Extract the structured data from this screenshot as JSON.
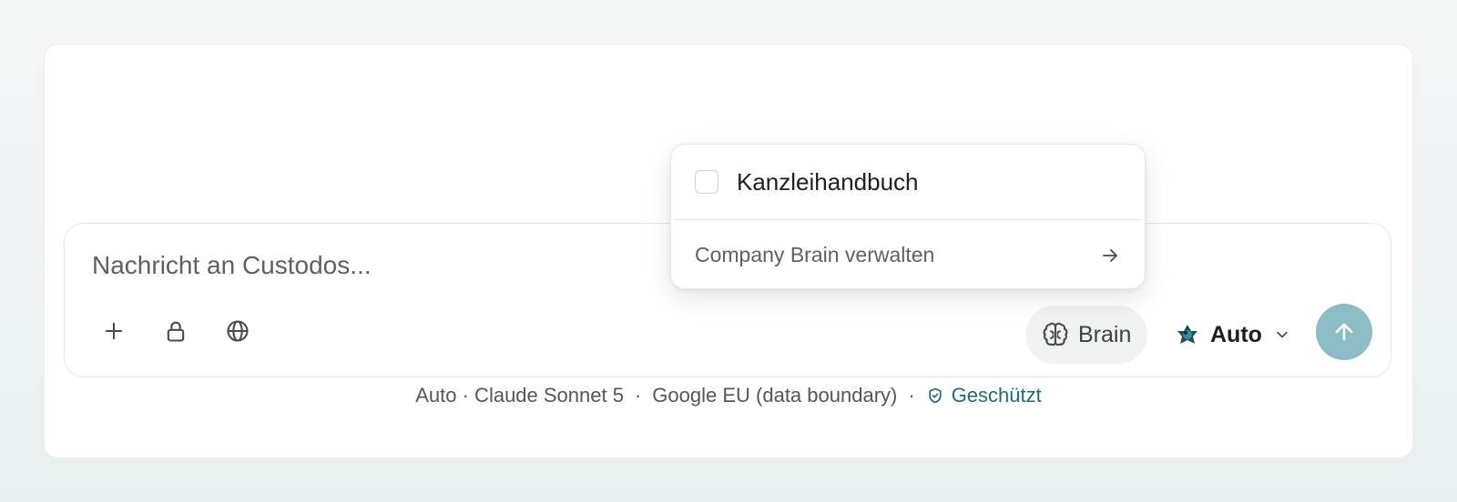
{
  "composer": {
    "placeholder": "Nachricht an Custodos...",
    "brain_label": "Brain",
    "model_label": "Auto"
  },
  "popover": {
    "items": [
      {
        "label": "Kanzleihandbuch",
        "checked": false
      }
    ],
    "manage_label": "Company Brain verwalten"
  },
  "footer": {
    "model_info": "Auto · Claude Sonnet 5",
    "separator": "·",
    "region": "Google EU (data boundary)",
    "protected_label": "Geschützt"
  },
  "icons": {
    "attach": "plus-icon",
    "private": "lock-icon",
    "web": "globe-icon",
    "brain": "brain-icon",
    "model_logo": "model-logo-icon",
    "dropdown": "chevron-down-icon",
    "send": "arrow-up-icon",
    "manage": "arrow-right-icon",
    "shield": "shield-check-icon"
  },
  "colors": {
    "send_button": "#8cbcc6",
    "protected_text": "#1f6a78",
    "brain_button_bg": "#f1f2f2"
  }
}
